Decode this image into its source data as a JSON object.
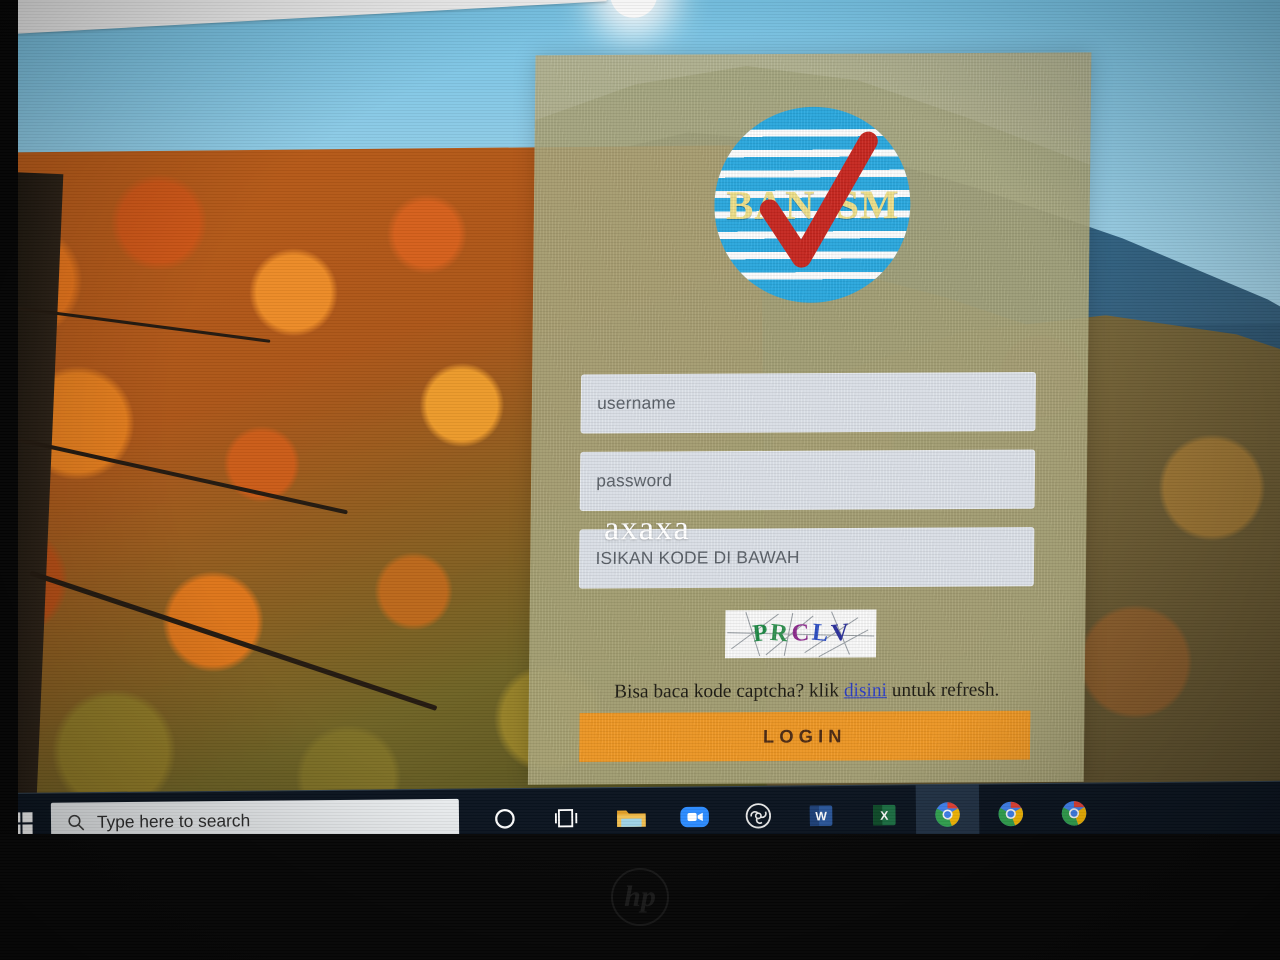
{
  "window": {
    "device_brand": "hp",
    "photo_of_screen": true
  },
  "wallpaper": {
    "description": "autumn-foliage-mountain-wallpaper",
    "sky_color": "#8ecbe6",
    "mountain_color": "#2f6f97",
    "foliage_color": "#b85d1c"
  },
  "login_card": {
    "background_color": "#a8a478",
    "logo": {
      "name": "ban-sm-logo",
      "left_text": "BAN",
      "right_text": "SM",
      "circle_color": "#29a9e0",
      "text_color": "#efe08a",
      "check_color": "#c8261f"
    },
    "fields": [
      {
        "name": "username-input",
        "placeholder": "username",
        "value": ""
      },
      {
        "name": "password-input",
        "placeholder": "password",
        "value": ""
      },
      {
        "name": "captcha-code-input",
        "placeholder": "ISIKAN KODE DI BAWAH",
        "value": ""
      }
    ],
    "watermark_text": "axaxa",
    "captcha": {
      "code": "PRCLV",
      "letters": [
        {
          "char": "P",
          "color": "#1f8a46"
        },
        {
          "char": "R",
          "color": "#2f9150"
        },
        {
          "char": "C",
          "color": "#8e2a8e"
        },
        {
          "char": "L",
          "color": "#2e4fc4"
        },
        {
          "char": "V",
          "color": "#2a2f9c"
        }
      ]
    },
    "hint": {
      "before_link": "Bisa baca kode captcha? klik ",
      "link_text": "disini",
      "after_link": " untuk refresh.",
      "link_color": "#2c3ec6"
    },
    "login_button": {
      "label": "LOGIN",
      "background_color": "#ef9723",
      "text_color": "#4d2a12"
    }
  },
  "taskbar": {
    "background_color": "#0b1420",
    "start_button": "windows-start-icon",
    "search": {
      "placeholder": "Type here to search",
      "icon": "search-icon"
    },
    "items": [
      {
        "name": "cortana-icon",
        "label": "Cortana",
        "state": "idle"
      },
      {
        "name": "task-view-icon",
        "label": "Task View",
        "state": "idle"
      },
      {
        "name": "file-explorer-icon",
        "label": "File Explorer",
        "state": "open"
      },
      {
        "name": "zoom-icon",
        "label": "Zoom",
        "state": "idle"
      },
      {
        "name": "obs-studio-icon",
        "label": "OBS Studio",
        "state": "idle"
      },
      {
        "name": "word-icon",
        "label": "Microsoft Word",
        "state": "open"
      },
      {
        "name": "excel-icon",
        "label": "Microsoft Excel",
        "state": "idle"
      },
      {
        "name": "chrome-icon-1",
        "label": "Google Chrome",
        "state": "active"
      },
      {
        "name": "chrome-icon-2",
        "label": "Google Chrome",
        "state": "open"
      },
      {
        "name": "chrome-icon-3",
        "label": "Google Chrome",
        "state": "open"
      }
    ]
  }
}
